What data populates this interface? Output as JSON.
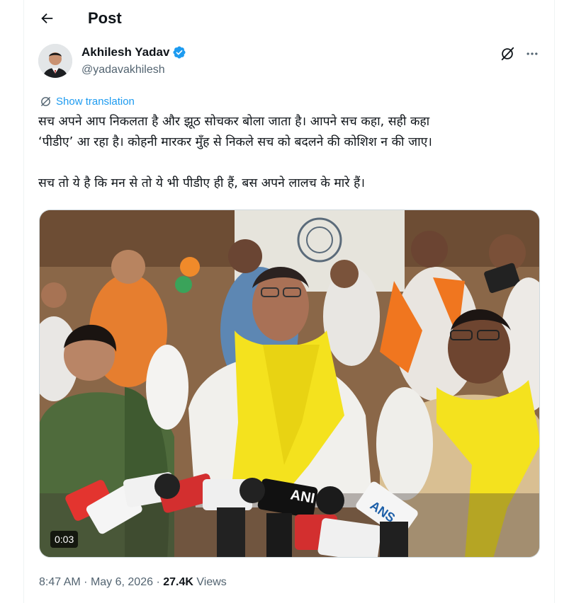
{
  "header": {
    "title": "Post",
    "back_label": "Back"
  },
  "author": {
    "name": "Akhilesh Yadav",
    "handle": "@yadavakhilesh",
    "verified": true,
    "avatar_icon": "avatar-photo"
  },
  "translate": {
    "label": "Show translation",
    "icon": "translate-icon"
  },
  "tweet": {
    "line1": "सच अपने आप निकलता है और झूठ सोचकर बोला जाता है। आपने सच कहा, सही कहा",
    "line2": "‘पीडीए’ आ रहा है। कोहनी मारकर मुँह से निकले सच को बदलने की कोशिश न की जाए।",
    "line3": "सच तो ये है कि मन से तो ये भी पीडीए ही हैं, बस अपने लालच के मारे हैं।"
  },
  "media": {
    "duration": "0:03",
    "mic_labels": [
      "ANI",
      "ANS"
    ]
  },
  "meta": {
    "time": "8:47 AM",
    "separator": "·",
    "date": "May 6, 2026",
    "views_count": "27.4K",
    "views_label": "Views"
  },
  "colors": {
    "accent": "#1d9bf0",
    "text": "#0f1419",
    "muted": "#536471"
  }
}
